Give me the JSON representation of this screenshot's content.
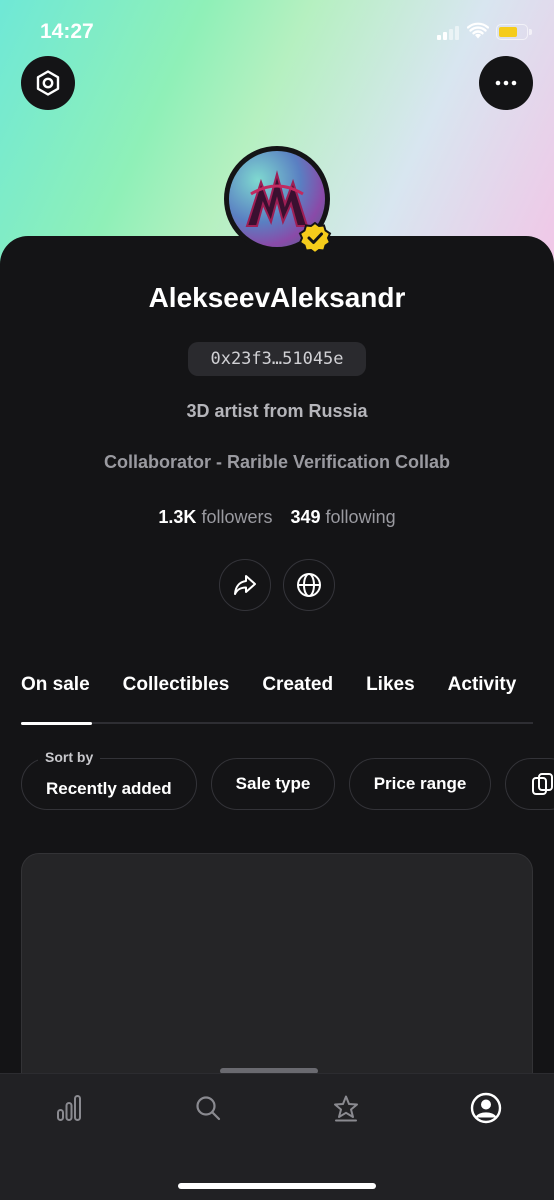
{
  "status_bar": {
    "time": "14:27"
  },
  "profile": {
    "username": "AlekseevAleksandr",
    "address": "0x23f3…51045e",
    "bio": "3D artist from Russia",
    "collab": "Collaborator  - Rarible Verification Collab",
    "followers_count": "1.3K",
    "followers_label": "followers",
    "following_count": "349",
    "following_label": "following"
  },
  "tabs": [
    {
      "label": "On sale",
      "active": true
    },
    {
      "label": "Collectibles"
    },
    {
      "label": "Created"
    },
    {
      "label": "Likes"
    },
    {
      "label": "Activity"
    }
  ],
  "filters": {
    "sort_caption": "Sort by",
    "sort_value": "Recently added",
    "sale_type": "Sale type",
    "price_range": "Price range"
  },
  "colors": {
    "background": "#141416",
    "verified_badge": "#f5cc1b",
    "battery": "#f5cc1b"
  },
  "icons": {
    "settings": "hexagon-settings-icon",
    "more": "more-dots-icon",
    "share": "share-arrow-icon",
    "website": "globe-icon",
    "nav": [
      "stats-icon",
      "search-icon",
      "star-icon",
      "profile-icon"
    ]
  }
}
